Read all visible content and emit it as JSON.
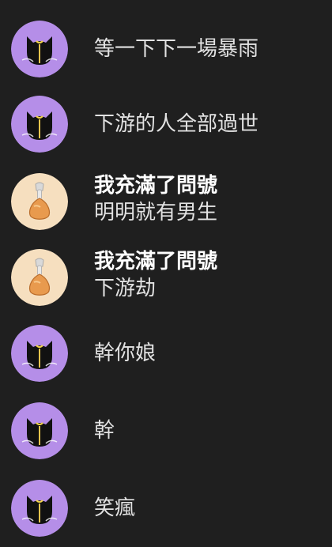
{
  "colors": {
    "background": "#1f1f1f",
    "cat_avatar_bg": "#b58ee8",
    "chicken_avatar_bg": "#f6dfbf"
  },
  "messages": [
    {
      "avatar": "cat-icon",
      "sender": "",
      "text": "等一下下一場暴雨"
    },
    {
      "avatar": "cat-icon",
      "sender": "",
      "text": "下游的人全部過世"
    },
    {
      "avatar": "chicken-leg-icon",
      "sender": "我充滿了問號",
      "text": "明明就有男生"
    },
    {
      "avatar": "chicken-leg-icon",
      "sender": "我充滿了問號",
      "text": "下游劫"
    },
    {
      "avatar": "cat-icon",
      "sender": "",
      "text": "幹你娘"
    },
    {
      "avatar": "cat-icon",
      "sender": "",
      "text": "幹"
    },
    {
      "avatar": "cat-icon",
      "sender": "",
      "text": "笑瘋"
    }
  ]
}
